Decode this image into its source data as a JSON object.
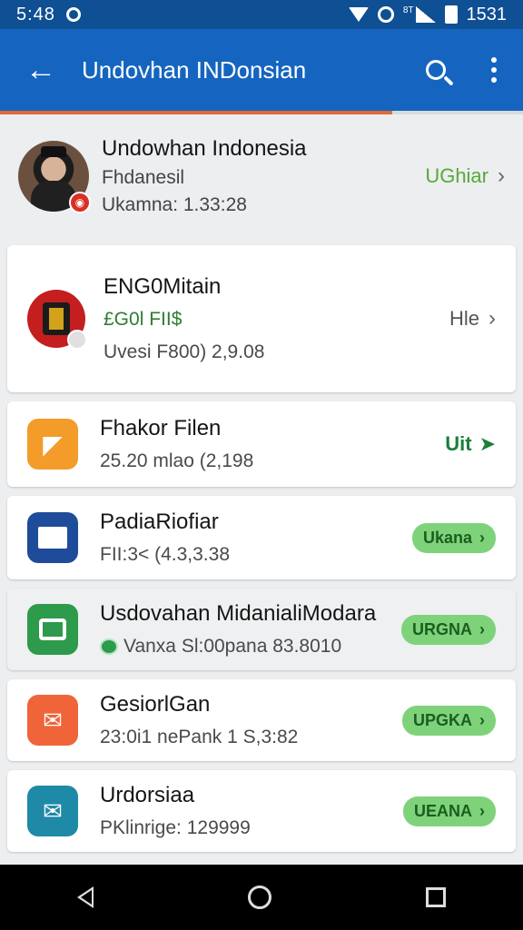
{
  "status": {
    "time": "5:48",
    "mini_label": "8T",
    "clock_right": "1531"
  },
  "header": {
    "title": "Undovhan INDonsian",
    "progress_fraction": 0.75
  },
  "profile": {
    "name": "Undowhan Indonesia",
    "subtitle": "Fhdanesil",
    "meta": "Ukamna: 1.33:28",
    "action": "UGhiar"
  },
  "items": [
    {
      "title": "ENG0Mitain",
      "line1": "£G0l FII$",
      "line2": "Uvesi F800)  2,9.08",
      "action": "Hle",
      "icon": "app-emblem-icon"
    },
    {
      "title": "Fhakor Filen",
      "line": "25.20 mlao (2,198",
      "action": "Uit",
      "icon": "bell-icon",
      "color": "#f39c2a"
    },
    {
      "title": "PadiaRiofiar",
      "line": "FII:3< (4.3,3.38",
      "action": "Ukana",
      "icon": "card-edit-icon",
      "color": "#1f4c9a"
    },
    {
      "title": "Usdovahan MidanialiModara",
      "line": "Vanxa Sl:00pana 83.8010",
      "action": "URGNA",
      "icon": "window-icon",
      "color": "#2e9a4b"
    },
    {
      "title": "GesiorlGan",
      "line": "23:0i1 nePank 1 S,3:82",
      "action": "UPGKA",
      "icon": "mail-icon",
      "color": "#f0643a"
    },
    {
      "title": "Urdorsiaa",
      "line": "PKlinrige: 129999",
      "action": "UEANA",
      "icon": "envelope-icon",
      "color": "#1e8aa8"
    }
  ]
}
